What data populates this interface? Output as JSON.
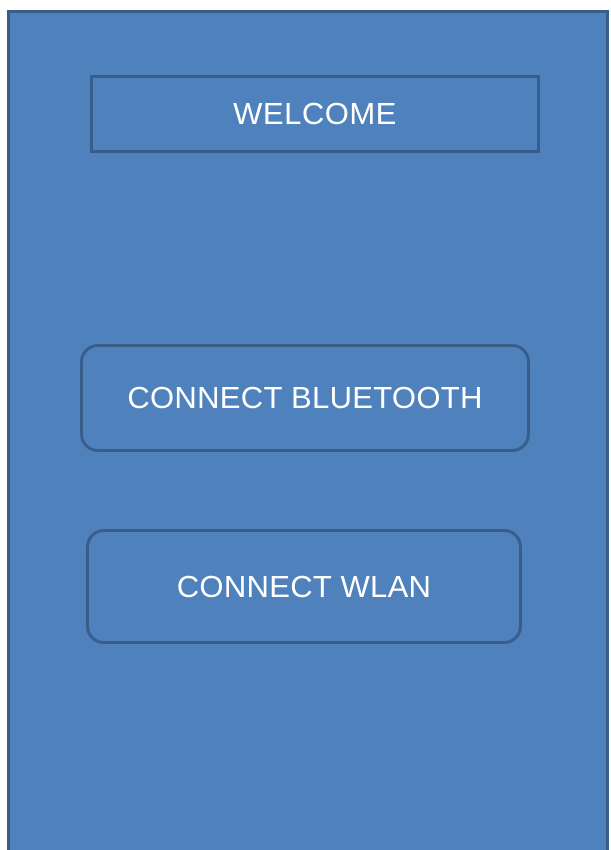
{
  "header": {
    "welcome_text": "WELCOME"
  },
  "actions": {
    "bluetooth_label": "CONNECT BLUETOOTH",
    "wlan_label": "CONNECT WLAN"
  },
  "colors": {
    "background": "#4f81bd",
    "border": "#385d8a",
    "text": "#ffffff"
  }
}
